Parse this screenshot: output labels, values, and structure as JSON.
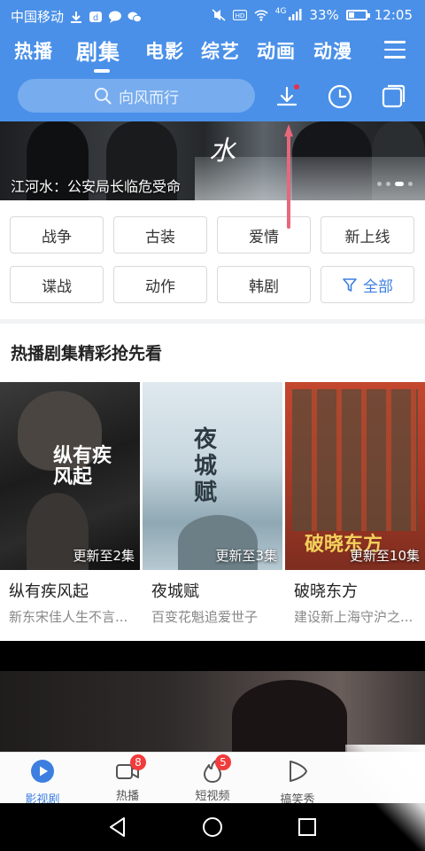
{
  "status_bar": {
    "carrier": "中国移动",
    "network": "4G",
    "battery": "33%",
    "time": "12:05"
  },
  "tabs": [
    {
      "label": "热播"
    },
    {
      "label": "剧集"
    },
    {
      "label": "电影"
    },
    {
      "label": "综艺"
    },
    {
      "label": "动画"
    },
    {
      "label": "动漫"
    }
  ],
  "active_tab": "剧集",
  "search": {
    "placeholder": "向风而行"
  },
  "header_icons": [
    "download-icon",
    "history-icon",
    "window-icon"
  ],
  "banner": {
    "caption": "江河水：公安局长临危受命",
    "overlay_text": "水"
  },
  "genres": [
    {
      "label": "战争"
    },
    {
      "label": "古装"
    },
    {
      "label": "爱情"
    },
    {
      "label": "新上线"
    },
    {
      "label": "谍战"
    },
    {
      "label": "动作"
    },
    {
      "label": "韩剧"
    },
    {
      "label": "全部"
    }
  ],
  "section": {
    "title": "热播剧集精彩抢先看",
    "cards": [
      {
        "poster_text": "纵有疾风起",
        "badge": "更新至2集",
        "title": "纵有疾风起",
        "subtitle": "新东宋佳人生不言..."
      },
      {
        "poster_text": "夜城赋",
        "badge": "更新至3集",
        "title": "夜城赋",
        "subtitle": "百变花魁追爱世子"
      },
      {
        "poster_text": "破晓东方",
        "badge": "更新至10集",
        "title": "破晓东方",
        "subtitle": "建设新上海守沪之..."
      }
    ]
  },
  "bottom_nav": [
    {
      "label": "影视剧",
      "icon": "play-circle-icon",
      "badge": ""
    },
    {
      "label": "热播",
      "icon": "video-camera-icon",
      "badge": "8"
    },
    {
      "label": "短视频",
      "icon": "fire-icon",
      "badge": "5"
    },
    {
      "label": "搞笑秀",
      "icon": "play-bubble-icon",
      "badge": ""
    }
  ],
  "colors": {
    "brand_blue": "#4a90e8",
    "accent_blue": "#3d7fe0",
    "badge_red": "#f23b3b",
    "annotation_arrow": "#e8677a"
  }
}
